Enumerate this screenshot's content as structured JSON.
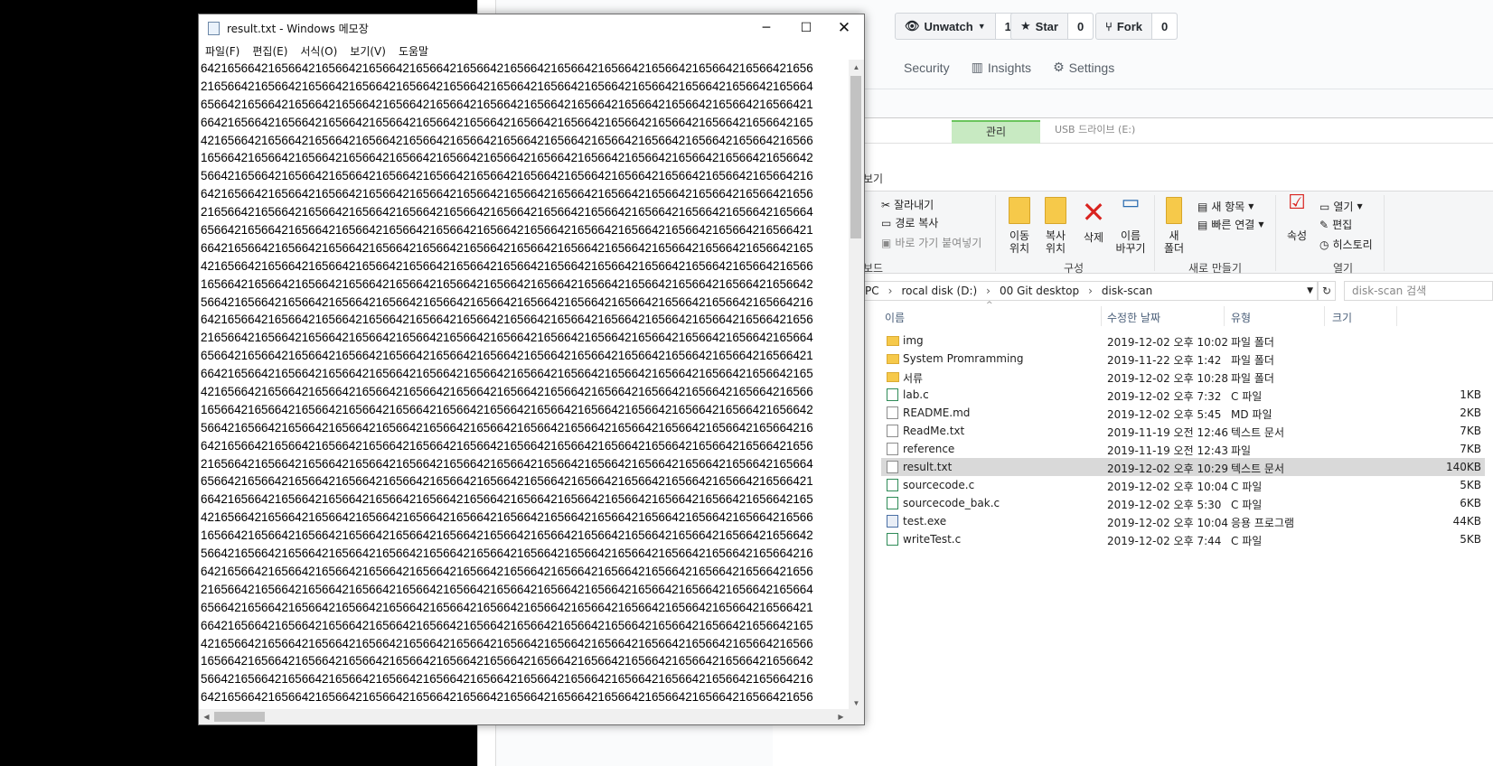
{
  "github": {
    "unwatch_label": "Unwatch",
    "watch_count": "1",
    "star_label": "Star",
    "star_count": "0",
    "fork_label": "Fork",
    "fork_count": "0",
    "tabs": [
      "Security",
      "Insights",
      "Settings"
    ]
  },
  "explorer": {
    "manage_tab": "관리",
    "drive_tab": "USB 드라이브 (E:)",
    "ribbon_tab_partial": "보기",
    "clipboard": {
      "cut": "잘라내기",
      "copy_path": "경로 복사",
      "paste_shortcut": "바로 가기 붙여넣기",
      "group_partial": "보드"
    },
    "organize": {
      "move": "이동",
      "move2": "위치",
      "copy": "복사",
      "copy2": "위치",
      "delete": "삭제",
      "rename": "이름",
      "rename2": "바꾸기",
      "group": "구성"
    },
    "new": {
      "new_folder": "새",
      "new_folder2": "폴더",
      "new_item": "새 항목",
      "easy_access": "빠른 연결",
      "group": "새로 만들기"
    },
    "open": {
      "properties": "속성",
      "open": "열기",
      "edit": "편집",
      "history": "히스토리",
      "group": "열기"
    },
    "address": {
      "crumbs": [
        "PC",
        "rocal disk (D:)",
        "00 Git desktop",
        "disk-scan"
      ],
      "search_placeholder": "disk-scan 검색"
    },
    "columns": {
      "name": "이름",
      "modified": "수정한 날짜",
      "type": "유형",
      "size": "크기"
    },
    "files": [
      {
        "name": "img",
        "date": "2019-12-02 오후 10:02",
        "type": "파일 폴더",
        "size": "",
        "icon": "folder-icon"
      },
      {
        "name": "System Promramming",
        "date": "2019-11-22 오후 1:42",
        "type": "파일 폴더",
        "size": "",
        "icon": "folder-icon"
      },
      {
        "name": "서류",
        "date": "2019-12-02 오후 10:28",
        "type": "파일 폴더",
        "size": "",
        "icon": "folder-icon"
      },
      {
        "name": "lab.c",
        "date": "2019-12-02 오후 7:32",
        "type": "C 파일",
        "size": "1KB",
        "icon": "c-file-icon"
      },
      {
        "name": "README.md",
        "date": "2019-12-02 오후 5:45",
        "type": "MD 파일",
        "size": "2KB",
        "icon": "document-icon"
      },
      {
        "name": "ReadMe.txt",
        "date": "2019-11-19 오전 12:46",
        "type": "텍스트 문서",
        "size": "7KB",
        "icon": "document-icon"
      },
      {
        "name": "reference",
        "date": "2019-11-19 오전 12:43",
        "type": "파일",
        "size": "7KB",
        "icon": "document-icon"
      },
      {
        "name": "result.txt",
        "date": "2019-12-02 오후 10:29",
        "type": "텍스트 문서",
        "size": "140KB",
        "icon": "document-icon",
        "selected": true
      },
      {
        "name": "sourcecode.c",
        "date": "2019-12-02 오후 10:04",
        "type": "C 파일",
        "size": "5KB",
        "icon": "c-file-icon"
      },
      {
        "name": "sourcecode_bak.c",
        "date": "2019-12-02 오후 5:30",
        "type": "C 파일",
        "size": "6KB",
        "icon": "c-file-icon"
      },
      {
        "name": "test.exe",
        "date": "2019-12-02 오후 10:04",
        "type": "응용 프로그램",
        "size": "44KB",
        "icon": "exe-icon"
      },
      {
        "name": "writeTest.c",
        "date": "2019-12-02 오후 7:44",
        "type": "C 파일",
        "size": "5KB",
        "icon": "c-file-icon"
      }
    ]
  },
  "notepad": {
    "title": "result.txt - Windows 메모장",
    "menu": [
      "파일(F)",
      "편집(E)",
      "서식(O)",
      "보기(V)",
      "도움말"
    ],
    "lines": [
      "6421656642165664216566421656642165664216566421656642165664216566421656642165664216566421656",
      "2165664216566421656642165664216566421656642165664216566421656642165664216566421656642165664",
      "6566421656642165664216566421656642165664216566421656642165664216566421656642165664216566421",
      "6642165664216566421656642165664216566421656642165664216566421656642165664216566421656642165",
      "4216566421656642165664216566421656642165664216566421656642165664216566421656642165664216566",
      "1656642165664216566421656642165664216566421656642165664216566421656642165664216566421656642",
      "5664216566421656642165664216566421656642165664216566421656642165664216566421656642165664216",
      "6421656642165664216566421656642165664216566421656642165664216566421656642165664216566421656",
      "2165664216566421656642165664216566421656642165664216566421656642165664216566421656642165664",
      "6566421656642165664216566421656642165664216566421656642165664216566421656642165664216566421",
      "6642165664216566421656642165664216566421656642165664216566421656642165664216566421656642165",
      "4216566421656642165664216566421656642165664216566421656642165664216566421656642165664216566",
      "1656642165664216566421656642165664216566421656642165664216566421656642165664216566421656642",
      "5664216566421656642165664216566421656642165664216566421656642165664216566421656642165664216",
      "6421656642165664216566421656642165664216566421656642165664216566421656642165664216566421656",
      "2165664216566421656642165664216566421656642165664216566421656642165664216566421656642165664",
      "6566421656642165664216566421656642165664216566421656642165664216566421656642165664216566421",
      "6642165664216566421656642165664216566421656642165664216566421656642165664216566421656642165",
      "4216566421656642165664216566421656642165664216566421656642165664216566421656642165664216566",
      "1656642165664216566421656642165664216566421656642165664216566421656642165664216566421656642",
      "5664216566421656642165664216566421656642165664216566421656642165664216566421656642165664216",
      "6421656642165664216566421656642165664216566421656642165664216566421656642165664216566421656",
      "2165664216566421656642165664216566421656642165664216566421656642165664216566421656642165664",
      "6566421656642165664216566421656642165664216566421656642165664216566421656642165664216566421",
      "6642165664216566421656642165664216566421656642165664216566421656642165664216566421656642165",
      "4216566421656642165664216566421656642165664216566421656642165664216566421656642165664216566",
      "1656642165664216566421656642165664216566421656642165664216566421656642165664216566421656642",
      "5664216566421656642165664216566421656642165664216566421656642165664216566421656642165664216",
      "6421656642165664216566421656642165664216566421656642165664216566421656642165664216566421656",
      "2165664216566421656642165664216566421656642165664216566421656642165664216566421656642165664",
      "6566421656642165664216566421656642165664216566421656642165664216566421656642165664216566421",
      "6642165664216566421656642165664216566421656642165664216566421656642165664216566421656642165",
      "4216566421656642165664216566421656642165664216566421656642165664216566421656642165664216566",
      "1656642165664216566421656642165664216566421656642165664216566421656642165664216566421656642",
      "5664216566421656642165664216566421656642165664216566421656642165664216566421656642165664216",
      "6421656642165664216566421656642165664216566421656642165664216566421656642165664216566421656"
    ]
  }
}
